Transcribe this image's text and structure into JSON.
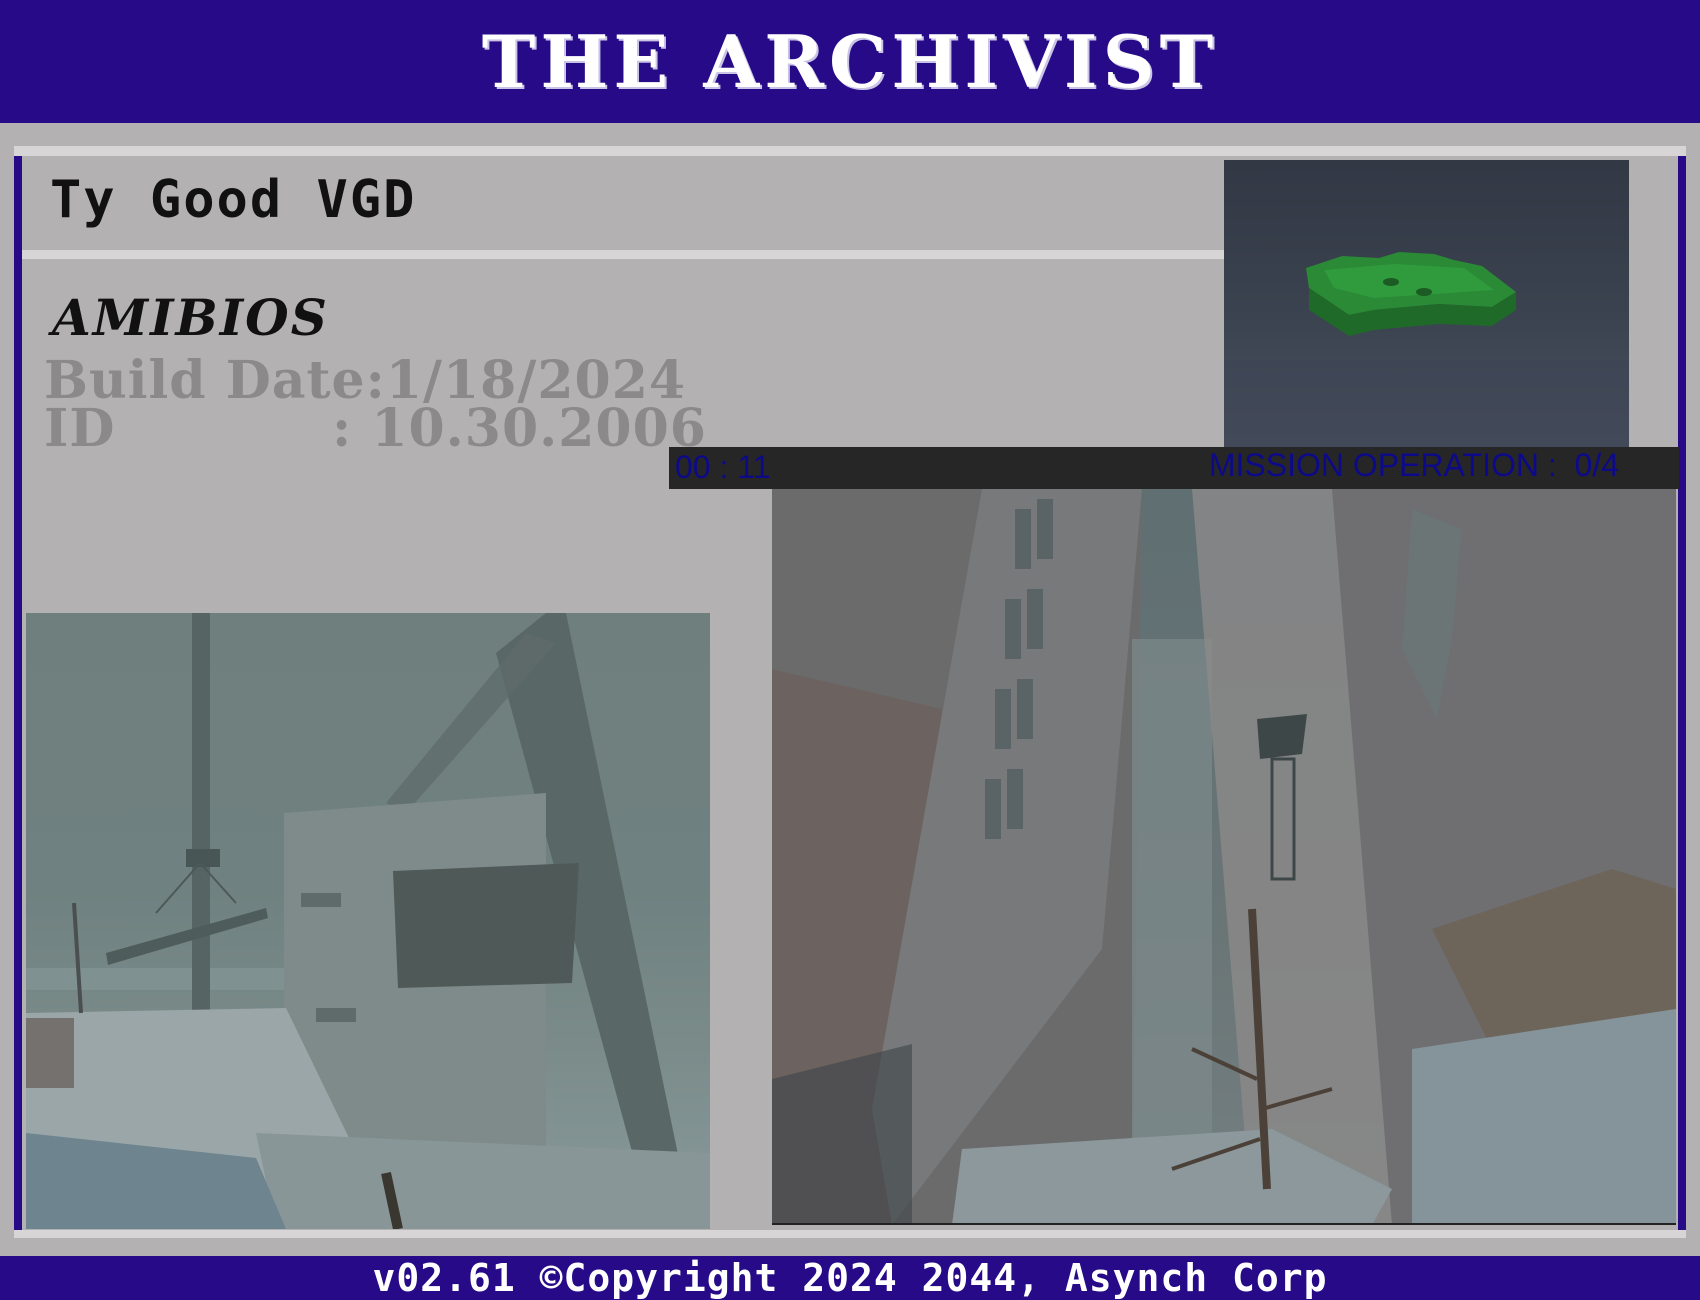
{
  "header": {
    "title": "THE ARCHIVIST"
  },
  "user": {
    "name": "Ty Good VGD"
  },
  "bios": {
    "vendor": "AMIBIOS",
    "build_label": "Build Date:",
    "build_date": "1/18/2024",
    "id_label": "ID",
    "id_separator": ":",
    "id_value": "10.30.2006"
  },
  "hud": {
    "timer": "00 : 11",
    "mission_label": "MISSION OPERATION :",
    "mission_progress": "0/4",
    "mission_done": 0,
    "mission_total": 4
  },
  "footer": {
    "text": "v02.61 ©Copyright 2024 2044, Asynch Corp"
  },
  "colors": {
    "brand_bar": "#260a87",
    "panel": "#b3b1b1",
    "hud_text": "#0d0a8a",
    "item_green": "#2e8f3a"
  },
  "scenes": {
    "item_preview": "green-keycard",
    "left": "foggy-construction-site",
    "right": "ruined-city-street"
  }
}
